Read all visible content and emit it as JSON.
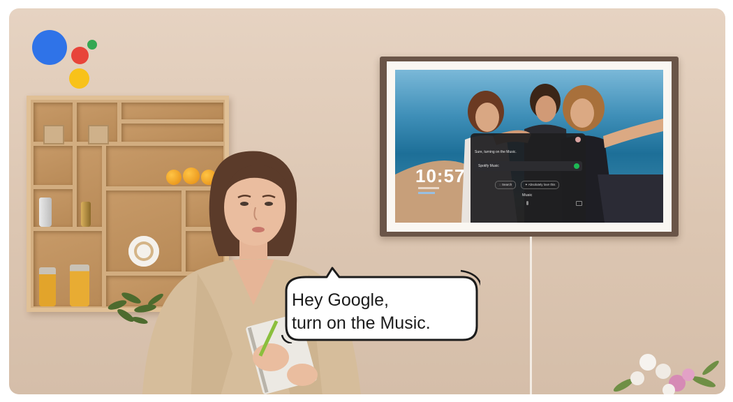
{
  "speech_bubble": {
    "line1": "Hey Google,",
    "line2": "turn on the Music."
  },
  "tv_screen": {
    "clock": "10:57",
    "assistant_response": "Sure, turning on the Music.",
    "music_source": "Spotify Music",
    "buttons": [
      "Search",
      "Absolutely love this"
    ],
    "section_title": "Music"
  },
  "assistant_logo_colors": {
    "blue": "#2f73e8",
    "red": "#e8443a",
    "yellow": "#f8c21a",
    "green": "#34a853"
  },
  "icons": [
    "google-assistant-logo-icon",
    "microphone-icon",
    "spotify-icon",
    "search-icon"
  ]
}
